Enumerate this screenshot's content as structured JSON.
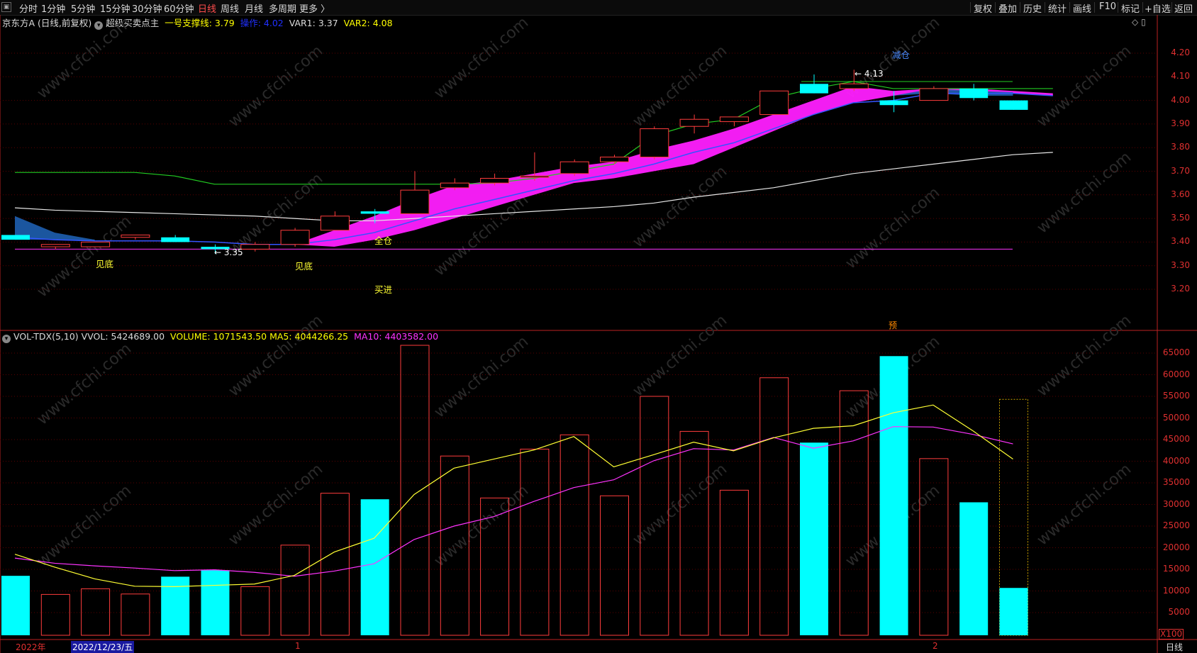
{
  "toolbar": {
    "periods": [
      "分时",
      "1分钟",
      "5分钟",
      "15分钟",
      "30分钟",
      "60分钟",
      "日线",
      "周线",
      "月线",
      "多周期",
      "更多 〉"
    ],
    "active_period": "日线",
    "right_buttons": [
      "复权",
      "叠加",
      "历史",
      "统计",
      "画线",
      "F10",
      "标记",
      "+自选",
      "返回"
    ]
  },
  "main_panel": {
    "stock_name": "京东方A",
    "period_info": "(日线,前复权)",
    "indicator_name": "超级买卖点主",
    "items": [
      {
        "label": "一号支撑线: 3.79",
        "color": "#ffff00"
      },
      {
        "label": "操作: 4.02",
        "color": "#0000ff"
      },
      {
        "label": "VAR1: 3.37",
        "color": "#dddddd"
      },
      {
        "label": "VAR2: 4.08",
        "color": "#ffff00"
      }
    ],
    "signals": {
      "jiandi1": "见底",
      "jiandi2": "见底",
      "maijin": "买进",
      "quancang": "全仓",
      "jiancang": "减仓",
      "low_mark": "← 3.35",
      "high_mark": "← 4.13",
      "yu": "预"
    },
    "y_axis": [
      "4.20",
      "4.10",
      "4.00",
      "3.90",
      "3.80",
      "3.70",
      "3.60",
      "3.50",
      "3.40",
      "3.30",
      "3.20"
    ],
    "watermark": "www.cfchi.com"
  },
  "volume_panel": {
    "indicator": "VOL-TDX(5,10)",
    "vvol": "VVOL: 5424689.00",
    "volume": "VOLUME: 1071543.50",
    "ma5": "MA5: 4044266.25",
    "ma10": "MA10: 4403582.00",
    "y_axis": [
      "65000",
      "60000",
      "55000",
      "50000",
      "45000",
      "40000",
      "35000",
      "30000",
      "25000",
      "20000",
      "15000",
      "10000",
      "5000"
    ],
    "unit": "X100"
  },
  "chart_data": [
    {
      "type": "candlestick",
      "title": "京东方A (日线,前复权)",
      "ylim": [
        3.1,
        4.25
      ],
      "candles": [
        {
          "open": 3.43,
          "high": 3.43,
          "low": 3.41,
          "close": 3.41,
          "up": false
        },
        {
          "open": 3.38,
          "high": 3.39,
          "low": 3.37,
          "close": 3.39,
          "up": true
        },
        {
          "open": 3.38,
          "high": 3.4,
          "low": 3.38,
          "close": 3.4,
          "up": true
        },
        {
          "open": 3.42,
          "high": 3.43,
          "low": 3.41,
          "close": 3.43,
          "up": true
        },
        {
          "open": 3.42,
          "high": 3.43,
          "low": 3.4,
          "close": 3.4,
          "up": false
        },
        {
          "open": 3.38,
          "high": 3.39,
          "low": 3.35,
          "close": 3.37,
          "up": false
        },
        {
          "open": 3.37,
          "high": 3.4,
          "low": 3.36,
          "close": 3.39,
          "up": true
        },
        {
          "open": 3.39,
          "high": 3.46,
          "low": 3.38,
          "close": 3.45,
          "up": true
        },
        {
          "open": 3.45,
          "high": 3.53,
          "low": 3.45,
          "close": 3.51,
          "up": true
        },
        {
          "open": 3.53,
          "high": 3.54,
          "low": 3.48,
          "close": 3.52,
          "up": false
        },
        {
          "open": 3.52,
          "high": 3.7,
          "low": 3.52,
          "close": 3.62,
          "up": true
        },
        {
          "open": 3.63,
          "high": 3.67,
          "low": 3.62,
          "close": 3.65,
          "up": true
        },
        {
          "open": 3.65,
          "high": 3.69,
          "low": 3.64,
          "close": 3.67,
          "up": true
        },
        {
          "open": 3.68,
          "high": 3.78,
          "low": 3.66,
          "close": 3.68,
          "up": true
        },
        {
          "open": 3.69,
          "high": 3.75,
          "low": 3.68,
          "close": 3.74,
          "up": true
        },
        {
          "open": 3.74,
          "high": 3.77,
          "low": 3.73,
          "close": 3.76,
          "up": true
        },
        {
          "open": 3.76,
          "high": 3.89,
          "low": 3.75,
          "close": 3.88,
          "up": true
        },
        {
          "open": 3.89,
          "high": 3.94,
          "low": 3.86,
          "close": 3.92,
          "up": true
        },
        {
          "open": 3.91,
          "high": 3.93,
          "low": 3.89,
          "close": 3.93,
          "up": true
        },
        {
          "open": 3.94,
          "high": 4.04,
          "low": 3.94,
          "close": 4.04,
          "up": true
        },
        {
          "open": 4.07,
          "high": 4.11,
          "low": 4.03,
          "close": 4.03,
          "up": false
        },
        {
          "open": 4.05,
          "high": 4.13,
          "low": 4.04,
          "close": 4.07,
          "up": true
        },
        {
          "open": 4.0,
          "high": 4.04,
          "low": 3.95,
          "close": 3.98,
          "up": false
        },
        {
          "open": 4.0,
          "high": 4.06,
          "low": 4.0,
          "close": 4.05,
          "up": true
        },
        {
          "open": 4.05,
          "high": 4.07,
          "low": 4.0,
          "close": 4.01,
          "up": false
        },
        {
          "open": 4.0,
          "high": 4.0,
          "low": 3.96,
          "close": 3.96,
          "up": false
        }
      ],
      "lines": {
        "white": [
          3.545,
          3.535,
          3.53,
          3.525,
          3.52,
          3.515,
          3.51,
          3.5,
          3.49,
          3.49,
          3.5,
          3.51,
          3.52,
          3.53,
          3.54,
          3.55,
          3.565,
          3.59,
          3.61,
          3.63,
          3.66,
          3.69,
          3.71,
          3.73,
          3.75,
          3.77,
          3.78
        ],
        "green": [
          3.695,
          3.695,
          3.695,
          3.695,
          3.68,
          3.645,
          3.645,
          3.645,
          3.645,
          3.645,
          3.645,
          3.645,
          3.65,
          3.67,
          3.7,
          3.73,
          3.85,
          3.9,
          3.92,
          4.01,
          4.05,
          4.08,
          4.05,
          4.05,
          4.05,
          4.05,
          4.05
        ],
        "blue": [
          3.42,
          3.41,
          3.405,
          3.405,
          3.405,
          3.4,
          3.39,
          3.39,
          3.41,
          3.44,
          3.49,
          3.54,
          3.58,
          3.62,
          3.66,
          3.69,
          3.73,
          3.78,
          3.82,
          3.88,
          3.94,
          3.99,
          4.0,
          4.03,
          4.03,
          4.03,
          4.02
        ],
        "pink_top": [
          3.4,
          3.4,
          3.4,
          3.4,
          3.4,
          3.39,
          3.38,
          3.39,
          3.45,
          3.51,
          3.58,
          3.64,
          3.66,
          3.69,
          3.72,
          3.74,
          3.79,
          3.83,
          3.88,
          3.94,
          4.0,
          4.06,
          4.04,
          4.05,
          4.05,
          4.04,
          4.03
        ],
        "pink_bottom": [
          3.4,
          3.4,
          3.4,
          3.4,
          3.4,
          3.39,
          3.38,
          3.39,
          3.38,
          3.41,
          3.45,
          3.5,
          3.55,
          3.6,
          3.65,
          3.67,
          3.7,
          3.73,
          3.8,
          3.87,
          3.94,
          3.99,
          4.02,
          4.04,
          4.04,
          4.03,
          4.02
        ],
        "var1": 3.37,
        "var2": 4.08
      }
    },
    {
      "type": "bar",
      "title": "VOL-TDX(5,10)",
      "ylabel": "X100",
      "ylim": [
        0,
        68000
      ],
      "values": [
        13500,
        9200,
        10500,
        9300,
        13300,
        14800,
        11000,
        20600,
        32600,
        31200,
        66800,
        41200,
        31500,
        42800,
        46100,
        32000,
        55000,
        46900,
        33300,
        59300,
        44300,
        56300,
        64300,
        40600,
        30500,
        10700
      ],
      "up": [
        false,
        true,
        true,
        true,
        false,
        false,
        true,
        true,
        true,
        false,
        true,
        true,
        true,
        true,
        true,
        true,
        true,
        true,
        true,
        true,
        false,
        true,
        false,
        true,
        false,
        false
      ],
      "predicted_last": 54300,
      "ma5": [
        18500,
        15500,
        12800,
        11100,
        11000,
        11300,
        11600,
        13600,
        19000,
        22200,
        32300,
        38400,
        40500,
        42600,
        45700,
        38700,
        41500,
        44400,
        42400,
        45400,
        47600,
        48200,
        51200,
        53000,
        47000,
        40500
      ],
      "ma10": [
        17600,
        16400,
        15800,
        15300,
        14700,
        14900,
        14300,
        13400,
        14600,
        16300,
        21900,
        25000,
        27200,
        30700,
        33900,
        35700,
        40100,
        42900,
        42600,
        45500,
        43000,
        44700,
        48000,
        47900,
        46200,
        44000
      ]
    }
  ],
  "x_axis": {
    "year_label": "2022年",
    "date_label": "2022/12/23/五",
    "month1": "1",
    "month2": "2",
    "period_label": "日线"
  }
}
